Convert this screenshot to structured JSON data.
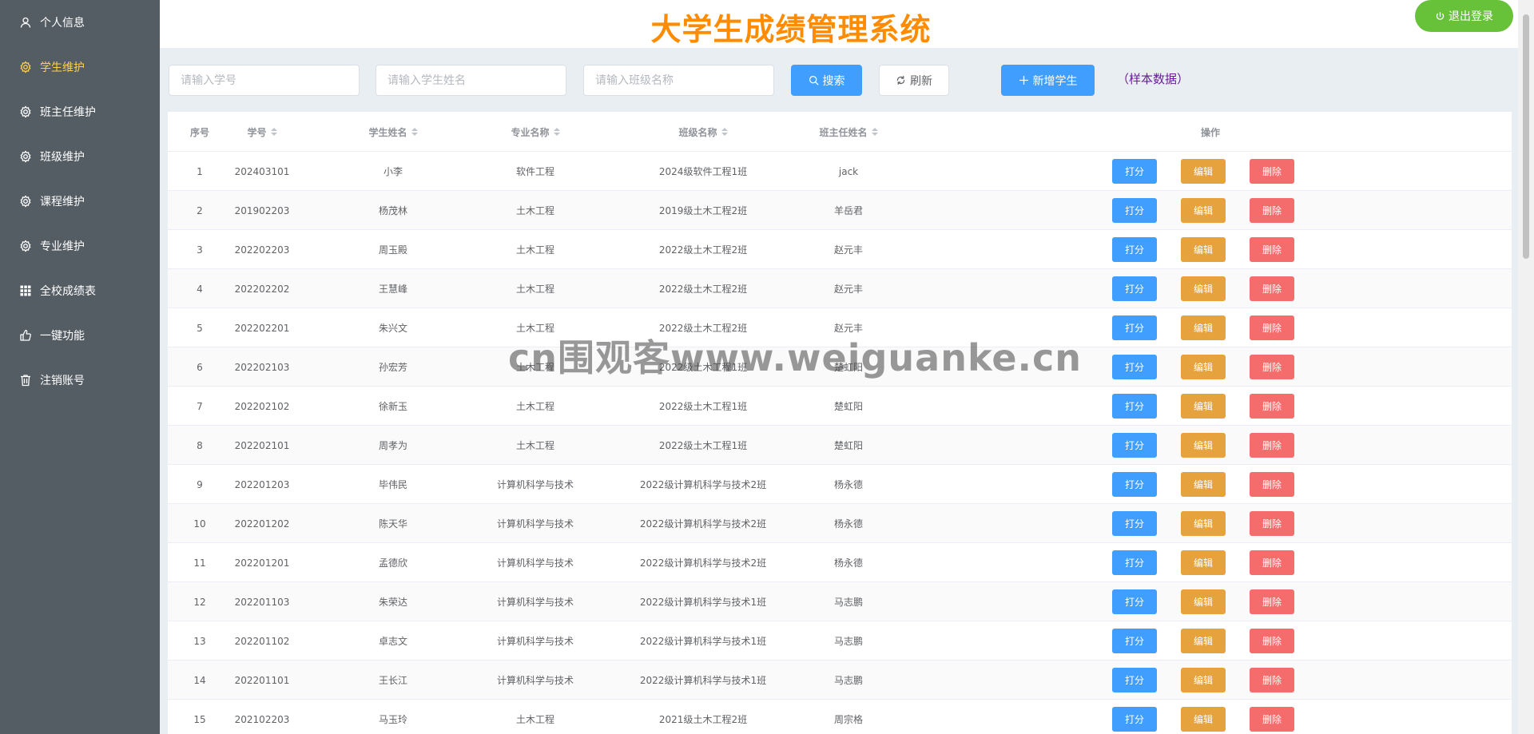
{
  "sidebar": {
    "items": [
      {
        "label": "个人信息",
        "icon": "user-icon",
        "active": false
      },
      {
        "label": "学生维护",
        "icon": "gear-icon",
        "active": true
      },
      {
        "label": "班主任维护",
        "icon": "gear-icon",
        "active": false
      },
      {
        "label": "班级维护",
        "icon": "gear-icon",
        "active": false
      },
      {
        "label": "课程维护",
        "icon": "gear-icon",
        "active": false
      },
      {
        "label": "专业维护",
        "icon": "gear-icon",
        "active": false
      },
      {
        "label": "全校成绩表",
        "icon": "grid-icon",
        "active": false
      },
      {
        "label": "一键功能",
        "icon": "thumb-icon",
        "active": false
      },
      {
        "label": "注销账号",
        "icon": "trash-icon",
        "active": false
      }
    ],
    "background": "#545c64",
    "active_color": "#ffd04b"
  },
  "header": {
    "title": "大学生成绩管理系统",
    "logout_label": "退出登录",
    "title_color": "#ff8c00"
  },
  "toolbar": {
    "student_id_placeholder": "请输入学号",
    "student_name_placeholder": "请输入学生姓名",
    "class_name_placeholder": "请输入班级名称",
    "search_label": "搜索",
    "refresh_label": "刷新",
    "add_label": "新增学生",
    "sample_label": "（样本数据）"
  },
  "table": {
    "columns": [
      "序号",
      "学号",
      "学生姓名",
      "专业名称",
      "班级名称",
      "班主任姓名",
      "操作"
    ],
    "actions": {
      "grade": "打分",
      "edit": "编辑",
      "delete": "删除"
    },
    "rows": [
      {
        "no": "1",
        "id": "202403101",
        "name": "小李",
        "major": "软件工程",
        "class": "2024级软件工程1班",
        "teacher": "jack"
      },
      {
        "no": "2",
        "id": "201902203",
        "name": "杨茂林",
        "major": "土木工程",
        "class": "2019级土木工程2班",
        "teacher": "羊岳君"
      },
      {
        "no": "3",
        "id": "202202203",
        "name": "周玉殿",
        "major": "土木工程",
        "class": "2022级土木工程2班",
        "teacher": "赵元丰"
      },
      {
        "no": "4",
        "id": "202202202",
        "name": "王慧峰",
        "major": "土木工程",
        "class": "2022级土木工程2班",
        "teacher": "赵元丰"
      },
      {
        "no": "5",
        "id": "202202201",
        "name": "朱兴文",
        "major": "土木工程",
        "class": "2022级土木工程2班",
        "teacher": "赵元丰"
      },
      {
        "no": "6",
        "id": "202202103",
        "name": "孙宏芳",
        "major": "土木工程",
        "class": "2022级土木工程1班",
        "teacher": "楚虹阳"
      },
      {
        "no": "7",
        "id": "202202102",
        "name": "徐新玉",
        "major": "土木工程",
        "class": "2022级土木工程1班",
        "teacher": "楚虹阳"
      },
      {
        "no": "8",
        "id": "202202101",
        "name": "周孝为",
        "major": "土木工程",
        "class": "2022级土木工程1班",
        "teacher": "楚虹阳"
      },
      {
        "no": "9",
        "id": "202201203",
        "name": "毕伟民",
        "major": "计算机科学与技术",
        "class": "2022级计算机科学与技术2班",
        "teacher": "杨永德"
      },
      {
        "no": "10",
        "id": "202201202",
        "name": "陈天华",
        "major": "计算机科学与技术",
        "class": "2022级计算机科学与技术2班",
        "teacher": "杨永德"
      },
      {
        "no": "11",
        "id": "202201201",
        "name": "孟德欣",
        "major": "计算机科学与技术",
        "class": "2022级计算机科学与技术2班",
        "teacher": "杨永德"
      },
      {
        "no": "12",
        "id": "202201103",
        "name": "朱荣达",
        "major": "计算机科学与技术",
        "class": "2022级计算机科学与技术1班",
        "teacher": "马志鹏"
      },
      {
        "no": "13",
        "id": "202201102",
        "name": "卓志文",
        "major": "计算机科学与技术",
        "class": "2022级计算机科学与技术1班",
        "teacher": "马志鹏"
      },
      {
        "no": "14",
        "id": "202201101",
        "name": "王长江",
        "major": "计算机科学与技术",
        "class": "2022级计算机科学与技术1班",
        "teacher": "马志鹏"
      },
      {
        "no": "15",
        "id": "202102203",
        "name": "马玉玲",
        "major": "土木工程",
        "class": "2021级土木工程2班",
        "teacher": "周宗格"
      }
    ]
  },
  "colors": {
    "primary": "#409eff",
    "warning": "#e6a23c",
    "danger": "#f56c6c",
    "success": "#67c23a"
  },
  "watermark": "cn围观客www.weiguanke.cn"
}
